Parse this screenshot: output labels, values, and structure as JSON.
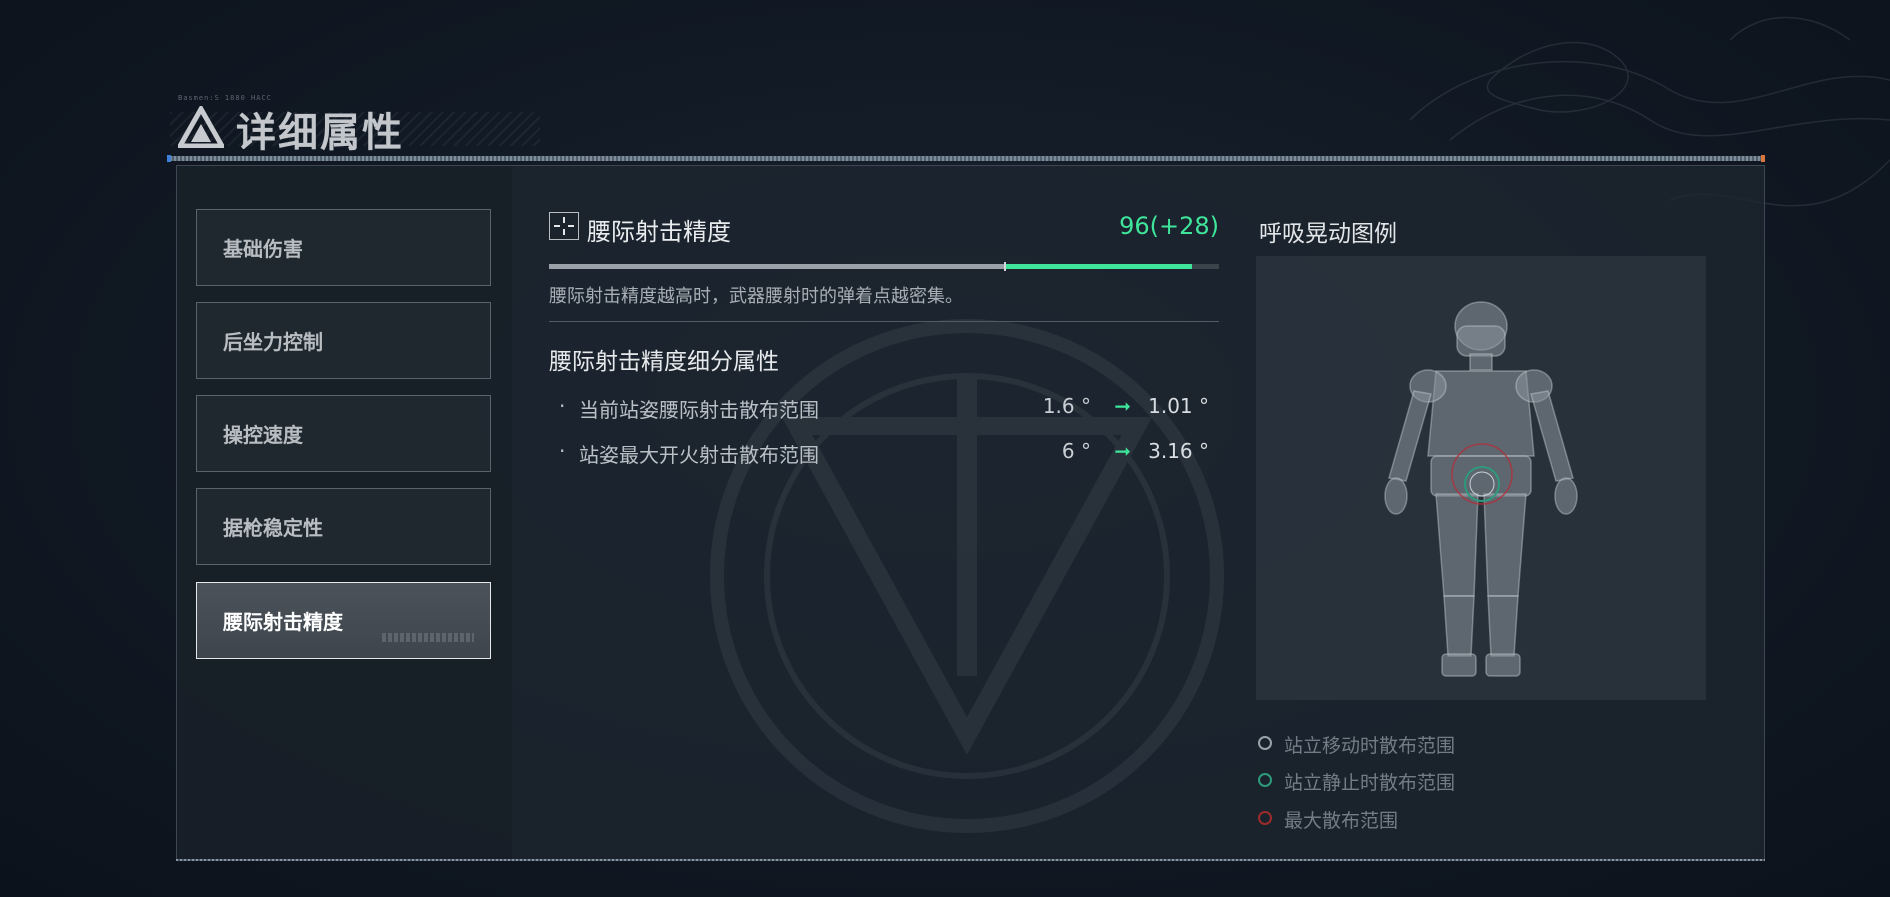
{
  "header": {
    "title": "详细属性",
    "small_text": "Basmen:S 1880 HACC",
    "icon": "triangle-logo-icon"
  },
  "sidebar": {
    "items": [
      {
        "label": "基础伤害",
        "active": false
      },
      {
        "label": "后坐力控制",
        "active": false
      },
      {
        "label": "操控速度",
        "active": false
      },
      {
        "label": "据枪稳定性",
        "active": false
      },
      {
        "label": "腰际射击精度",
        "active": true
      }
    ]
  },
  "stat": {
    "icon": "crosshair-icon",
    "name": "腰际射击精度",
    "value": "96(+28)",
    "base_fraction": 0.68,
    "total_fraction": 0.96,
    "description": "腰际射击精度越高时，武器腰射时的弹着点越密集。"
  },
  "breakdown": {
    "title": "腰际射击精度细分属性",
    "rows": [
      {
        "bullet": "·",
        "label": "当前站姿腰际射击散布范围",
        "old": "1.6 °",
        "arrow": "➞",
        "new": "1.01 °"
      },
      {
        "bullet": "·",
        "label": "站姿最大开火射击散布范围",
        "old": "6 °",
        "arrow": "➞",
        "new": "3.16 °"
      }
    ]
  },
  "legend": {
    "title": "呼吸晃动图例",
    "items": [
      {
        "label": "站立移动时散布范围",
        "color": "#9aa2aa"
      },
      {
        "label": "站立静止时散布范围",
        "color": "#2e9a7c"
      },
      {
        "label": "最大散布范围",
        "color": "#9b2b2b"
      }
    ]
  },
  "colors": {
    "accent_green": "#3ee59a",
    "panel_bg": "#1e262f",
    "max_spread_red": "#b0303a"
  }
}
